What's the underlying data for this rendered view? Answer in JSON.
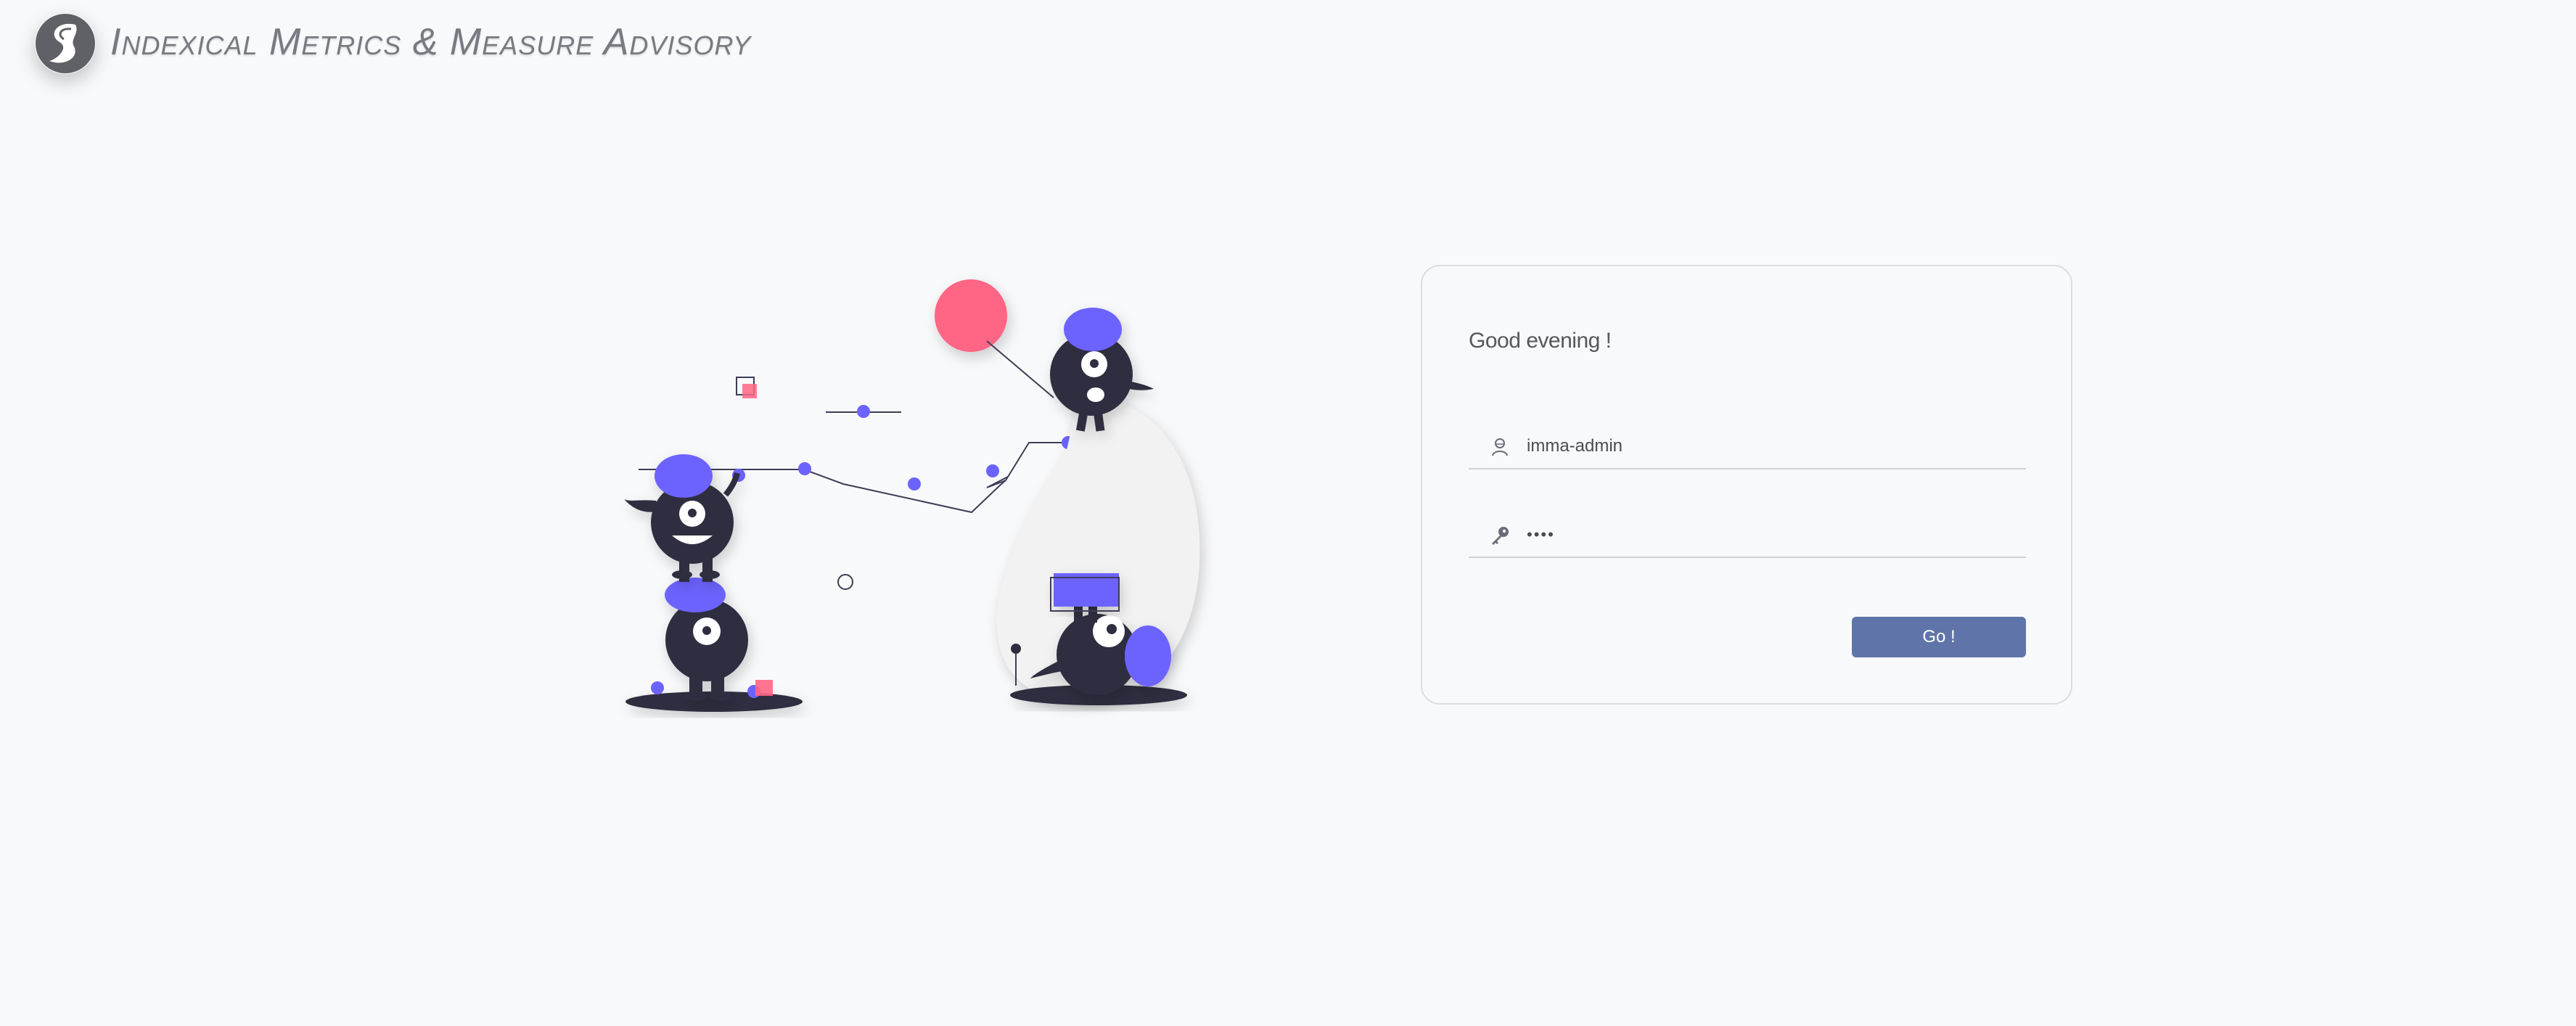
{
  "header": {
    "brand_name": "Indexical Metrics & Measure Advisory",
    "logo_icon": "s-swoosh-logo-icon"
  },
  "login": {
    "greeting": "Good evening !",
    "username": {
      "value": "imma-admin",
      "icon": "user-icon"
    },
    "password": {
      "value": "••••",
      "icon": "key-icon"
    },
    "submit_label": "Go !"
  },
  "colors": {
    "accent_purple": "#6c63ff",
    "accent_pink": "#ff6584",
    "dark_figure": "#2f2e41",
    "button": "#5f75a9",
    "background": "#f8f9fb"
  }
}
